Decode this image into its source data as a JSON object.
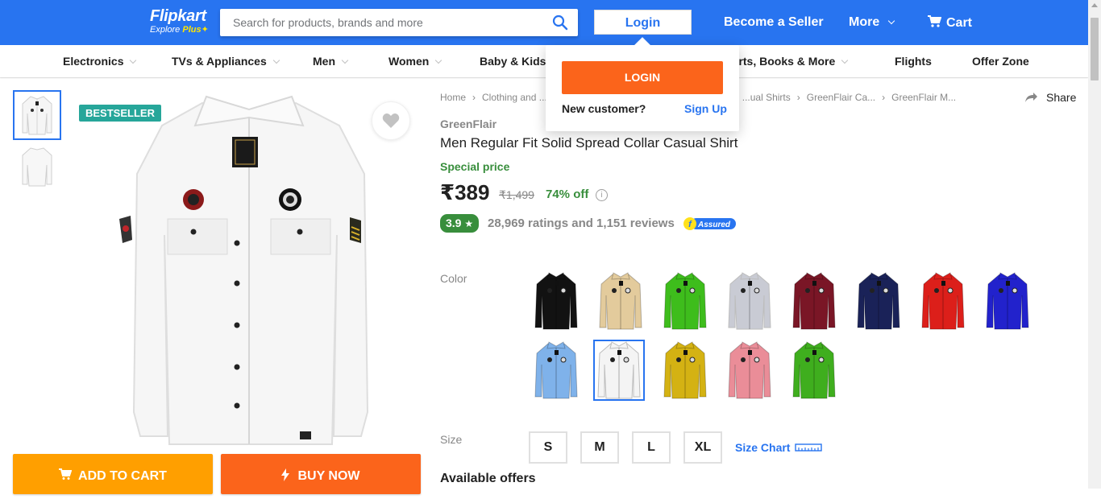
{
  "header": {
    "logo_brand": "Flipkart",
    "logo_tag": "Explore",
    "logo_plus": "Plus",
    "search_placeholder": "Search for products, brands and more",
    "login": "Login",
    "become_seller": "Become a Seller",
    "more": "More",
    "cart": "Cart",
    "bar_color": "#2874f0"
  },
  "categories": [
    "Electronics",
    "TVs & Appliances",
    "Men",
    "Women",
    "Baby & Kids",
    "Sports, Books & More",
    "Flights",
    "Offer Zone"
  ],
  "login_dropdown": {
    "login_button": "LOGIN",
    "new_customer": "New customer?",
    "sign_up": "Sign Up"
  },
  "gallery": {
    "badge": "BESTSELLER",
    "add_to_cart": "ADD TO CART",
    "buy_now": "BUY NOW"
  },
  "breadcrumbs": [
    "Home",
    "Clothing and ...",
    "...ual Shirts",
    "GreenFlair Ca...",
    "GreenFlair M..."
  ],
  "share": "Share",
  "product": {
    "brand": "GreenFlair",
    "title": "Men Regular Fit Solid Spread Collar Casual Shirt",
    "special_price": "Special price",
    "price": "₹389",
    "mrp": "₹1,499",
    "discount": "74% off",
    "info_icon": "i",
    "rating": "3.9",
    "rating_summary": "28,969 ratings and 1,151 reviews",
    "assured_label": "Assured"
  },
  "color_label": "Color",
  "colors": [
    "#121212",
    "#e3cb9c",
    "#3ebd1c",
    "#c9cbd4",
    "#7a1626",
    "#1a2258",
    "#dc1f1a",
    "#2222cc",
    "#7fb2ea",
    "#f4f4f4",
    "#d4b213",
    "#ea8d98",
    "#3fae1e"
  ],
  "selected_color_index": 9,
  "size_label": "Size",
  "sizes": [
    "S",
    "M",
    "L",
    "XL"
  ],
  "size_chart": "Size Chart",
  "available_offers": "Available offers"
}
